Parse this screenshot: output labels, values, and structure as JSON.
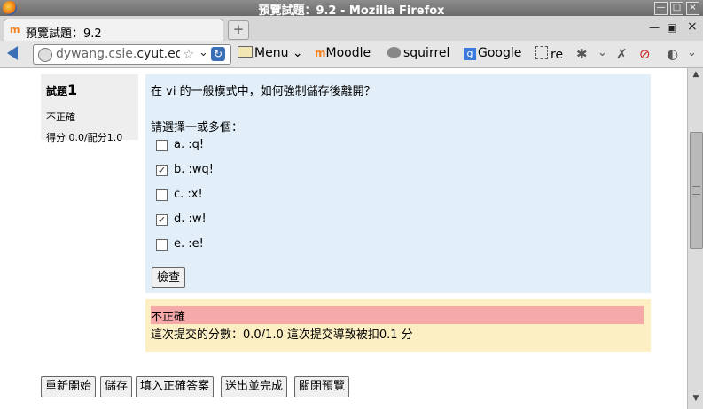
{
  "window": {
    "title": "預覽試題：9.2 - Mozilla Firefox",
    "controls": {
      "minimize": "—",
      "maximize": "□",
      "close": "×"
    }
  },
  "tab": {
    "favicon_text": "m",
    "label": "預覽試題：9.2",
    "new_tab": "+",
    "restore": "▣",
    "close": "×"
  },
  "nav": {
    "url_host": "dywang.csie.",
    "url_rest": "cyut.edu.tw",
    "bookmarks": {
      "menu": "Menu",
      "moodle": "Moodle",
      "squirrel": "squirrel",
      "google": "Google",
      "re": "re"
    }
  },
  "question": {
    "number_prefix": "試題",
    "number": "1",
    "state": "不正確",
    "grade": "得分 0.0/配分1.0",
    "text": "在 vi 的一般模式中，如何強制儲存後離開？",
    "prompt": "請選擇一或多個：",
    "options": [
      {
        "label": "a. :q!",
        "checked": false
      },
      {
        "label": "b. :wq!",
        "checked": true
      },
      {
        "label": "c. :x!",
        "checked": false
      },
      {
        "label": "d. :w!",
        "checked": true
      },
      {
        "label": "e. :e!",
        "checked": false
      }
    ],
    "check_button": "檢查"
  },
  "feedback": {
    "status": "不正確",
    "marks": "這次提交的分數：0.0/1.0 這次提交導致被扣0.1 分"
  },
  "controls": {
    "restart": "重新開始",
    "save": "儲存",
    "fill_correct": "填入正確答案",
    "submit_finish": "送出並完成",
    "close_preview": "關閉預覽"
  },
  "colors": {
    "question_bg": "#e2eef8",
    "info_bg": "#eeeeee",
    "feedback_bg": "#fcefc4",
    "incorrect_bar": "#f5a9a9"
  }
}
